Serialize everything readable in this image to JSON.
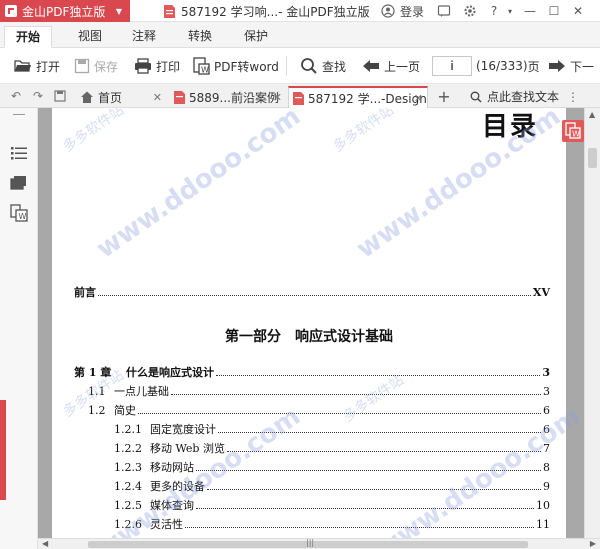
{
  "titlebar": {
    "app_name": "金山PDF独立版",
    "doc_title": "587192 学习响...- 金山PDF独立版",
    "login_label": "登录",
    "colors": {
      "brand": "#d9484e"
    }
  },
  "menu": {
    "tabs": [
      "开始",
      "视图",
      "注释",
      "转换",
      "保护"
    ],
    "active": "开始"
  },
  "toolbar": {
    "open_label": "打开",
    "save_label": "保存",
    "print_label": "打印",
    "pdf2word_label": "PDF转word",
    "find_label": "查找",
    "prev_label": "上一页",
    "page_value": "i",
    "page_count": "(16/333)",
    "page_unit": "页",
    "next_label": "下一"
  },
  "tabs": {
    "home_label": "首页",
    "tab1_label": "5889...前沿案例",
    "tab2_label": "587192 学...-Design",
    "search_label": "点此查找文本"
  },
  "document": {
    "toc_title": "目录",
    "preface": {
      "text": "前言",
      "page": "XV"
    },
    "part_title": "第一部分　响应式设计基础",
    "entries": [
      {
        "num": "第 1 章",
        "text": "什么是响应式设计",
        "page": "3",
        "level": 0
      },
      {
        "num": "1.1",
        "text": "一点儿基础",
        "page": "3",
        "level": 1
      },
      {
        "num": "1.2",
        "text": "简史",
        "page": "6",
        "level": 1
      },
      {
        "num": "1.2.1",
        "text": "固定宽度设计",
        "page": "6",
        "level": 2
      },
      {
        "num": "1.2.2",
        "text": "移动 Web 浏览",
        "page": "7",
        "level": 2
      },
      {
        "num": "1.2.3",
        "text": "移动网站",
        "page": "8",
        "level": 2
      },
      {
        "num": "1.2.4",
        "text": "更多的设备",
        "page": "9",
        "level": 2
      },
      {
        "num": "1.2.5",
        "text": "媒体查询",
        "page": "10",
        "level": 2
      },
      {
        "num": "1.2.6",
        "text": "灵活性",
        "page": "11",
        "level": 2
      }
    ]
  },
  "watermark": {
    "url_text": "www.ddooo.com",
    "cn_text": "多多软件站"
  }
}
